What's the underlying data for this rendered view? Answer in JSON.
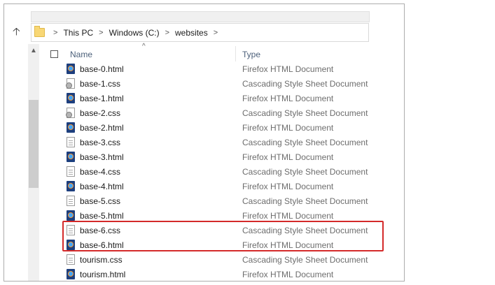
{
  "breadcrumb": {
    "up_icon": "up-arrow-icon",
    "folder_icon": "folder-icon",
    "items": [
      "This PC",
      "Windows (C:)",
      "websites"
    ],
    "separator": ">"
  },
  "header": {
    "name_label": "Name",
    "type_label": "Type",
    "sort_indicator": "^"
  },
  "files": [
    {
      "name": "base-0.html",
      "type": "Firefox HTML Document",
      "icon": "html-file-icon"
    },
    {
      "name": "base-1.css",
      "type": "Cascading Style Sheet Document",
      "icon": "gear-file-icon"
    },
    {
      "name": "base-1.html",
      "type": "Firefox HTML Document",
      "icon": "html-file-icon"
    },
    {
      "name": "base-2.css",
      "type": "Cascading Style Sheet Document",
      "icon": "gear-file-icon"
    },
    {
      "name": "base-2.html",
      "type": "Firefox HTML Document",
      "icon": "html-file-icon"
    },
    {
      "name": "base-3.css",
      "type": "Cascading Style Sheet Document",
      "icon": "css-file-icon"
    },
    {
      "name": "base-3.html",
      "type": "Firefox HTML Document",
      "icon": "html-file-icon"
    },
    {
      "name": "base-4.css",
      "type": "Cascading Style Sheet Document",
      "icon": "css-file-icon"
    },
    {
      "name": "base-4.html",
      "type": "Firefox HTML Document",
      "icon": "html-file-icon"
    },
    {
      "name": "base-5.css",
      "type": "Cascading Style Sheet Document",
      "icon": "css-file-icon"
    },
    {
      "name": "base-5.html",
      "type": "Firefox HTML Document",
      "icon": "html-file-icon"
    },
    {
      "name": "base-6.css",
      "type": "Cascading Style Sheet Document",
      "icon": "css-file-icon"
    },
    {
      "name": "base-6.html",
      "type": "Firefox HTML Document",
      "icon": "html-file-icon"
    },
    {
      "name": "tourism.css",
      "type": "Cascading Style Sheet Document",
      "icon": "css-file-icon"
    },
    {
      "name": "tourism.html",
      "type": "Firefox HTML Document",
      "icon": "html-file-icon"
    }
  ],
  "colors": {
    "highlight": "#d42a2a",
    "header_text": "#4c607a",
    "type_text": "#6d6d6d"
  }
}
